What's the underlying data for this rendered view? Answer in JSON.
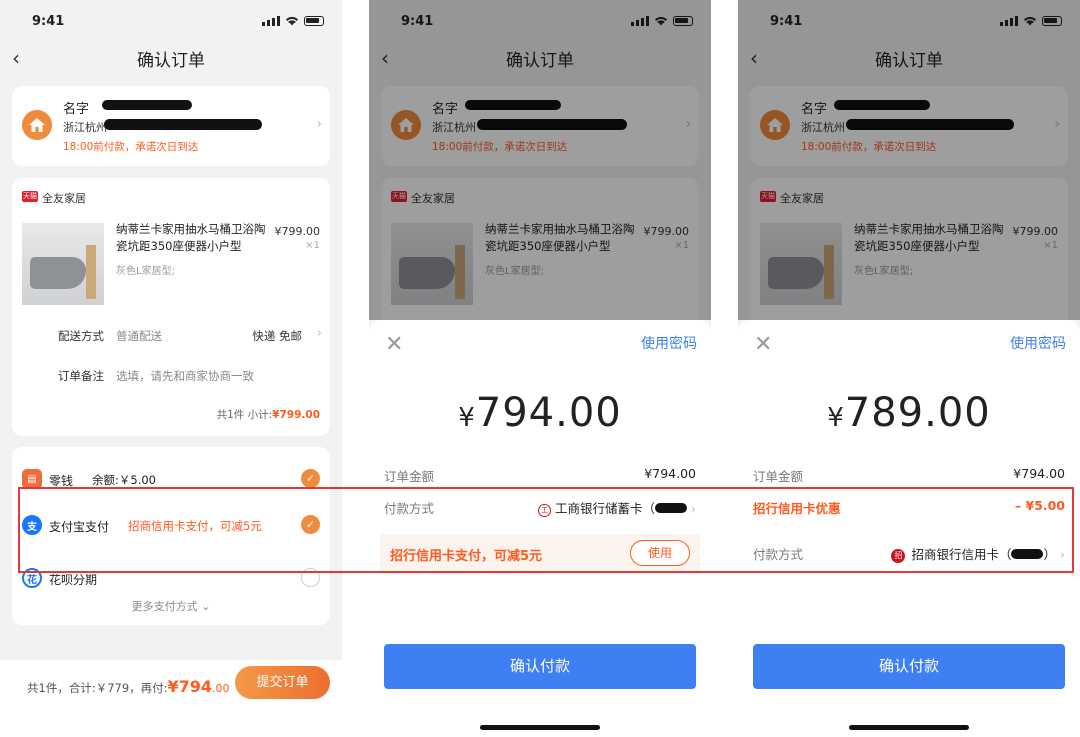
{
  "status_time": "9:41",
  "nav_title": "确认订单",
  "address": {
    "name_label": "名字",
    "line": "浙江杭州",
    "delivery_note": "18:00前付款，承诺次日到达"
  },
  "shop": {
    "badge": "天猫",
    "name": "全友家居",
    "product_title": "纳蒂兰卡家用抽水马桶卫浴陶瓷坑距350座便器小户型",
    "product_spec": "灰色L家居型;",
    "price": "¥799.00",
    "qty": "×1",
    "delivery_label": "配送方式",
    "delivery_value": "普通配送",
    "delivery_right": "快递 免邮",
    "remark_label": "订单备注",
    "remark_placeholder": "选填，请先和商家协商一致",
    "subtotal_prefix": "共1件  小计:",
    "subtotal_value": "¥799.00"
  },
  "payment": {
    "change_label": "零钱",
    "change_balance": "余额:￥5.00",
    "alipay_label": "支付宝支付",
    "alipay_promo": "招商信用卡支付，可减5元",
    "huabei_label": "花呗分期",
    "more_label": "更多支付方式"
  },
  "bottom": {
    "summary_prefix": "共1件，合计:￥779，再付:",
    "pay_amount": "¥794",
    "pay_cents": ".00",
    "submit_label": "提交订单"
  },
  "sheet_common": {
    "use_password": "使用密码",
    "order_amount_label": "订单金额",
    "order_amount_value": "¥794.00",
    "pay_method_label": "付款方式",
    "confirm_label": "确认付款"
  },
  "sheet2": {
    "amount_yen": "¥",
    "amount": "794.00",
    "bank": "工商银行储蓄卡（",
    "promo_text": "招行信用卡支付，可减5元",
    "promo_button": "使用"
  },
  "sheet3": {
    "amount_yen": "¥",
    "amount": "789.00",
    "discount_label": "招行信用卡优惠",
    "discount_value": "– ¥5.00",
    "bank": "招商银行信用卡（",
    "bank_suffix": "）"
  },
  "colors": {
    "accent_orange": "#ff5a1f",
    "confirm_blue": "#3f7ff4",
    "highlight_red": "#e03a3a"
  }
}
